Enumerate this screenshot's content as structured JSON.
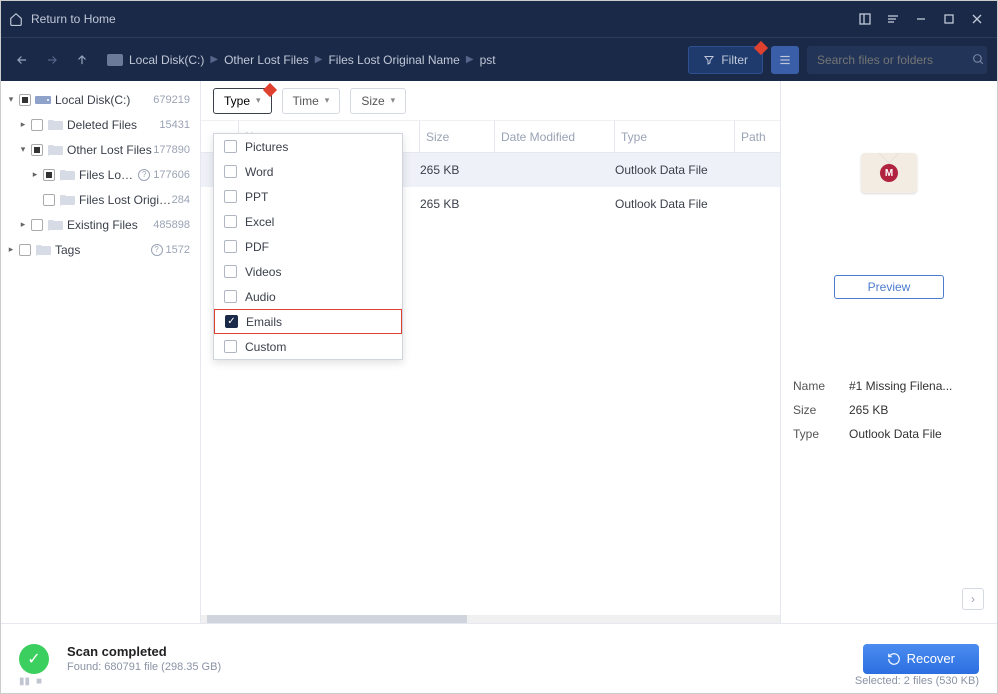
{
  "titlebar": {
    "home": "Return to Home"
  },
  "breadcrumb": {
    "disk": "Local Disk(C:)",
    "p1": "Other Lost Files",
    "p2": "Files Lost Original Name",
    "p3": "pst"
  },
  "toolbar": {
    "filter": "Filter",
    "search_ph": "Search files or folders"
  },
  "filters": {
    "type": "Type",
    "time": "Time",
    "size": "Size"
  },
  "typeOptions": {
    "pictures": "Pictures",
    "word": "Word",
    "ppt": "PPT",
    "excel": "Excel",
    "pdf": "PDF",
    "videos": "Videos",
    "audio": "Audio",
    "emails": "Emails",
    "custom": "Custom"
  },
  "tree": {
    "root": {
      "label": "Local Disk(C:)",
      "count": "679219"
    },
    "deleted": {
      "label": "Deleted Files",
      "count": "15431"
    },
    "other": {
      "label": "Other Lost Files",
      "count": "177890"
    },
    "floname": {
      "label": "Files Lost Origi...",
      "count": "177606"
    },
    "flodir": {
      "label": "Files Lost Original Dire...",
      "count": "284"
    },
    "existing": {
      "label": "Existing Files",
      "count": "485898"
    },
    "tags": {
      "label": "Tags",
      "count": "1572"
    }
  },
  "columns": {
    "name": "Name",
    "size": "Size",
    "date": "Date Modified",
    "type": "Type",
    "path": "Path"
  },
  "rows": [
    {
      "size": "265 KB",
      "type": "Outlook Data File"
    },
    {
      "size": "265 KB",
      "type": "Outlook Data File"
    }
  ],
  "preview": {
    "btn": "Preview",
    "seal": "M"
  },
  "details": {
    "name_k": "Name",
    "name_v": "#1 Missing Filena...",
    "size_k": "Size",
    "size_v": "265 KB",
    "type_k": "Type",
    "type_v": "Outlook Data File"
  },
  "footer": {
    "status": "Scan completed",
    "found": "Found: 680791 file (298.35 GB)",
    "recover": "Recover",
    "selected": "Selected: 2 files (530 KB)"
  }
}
